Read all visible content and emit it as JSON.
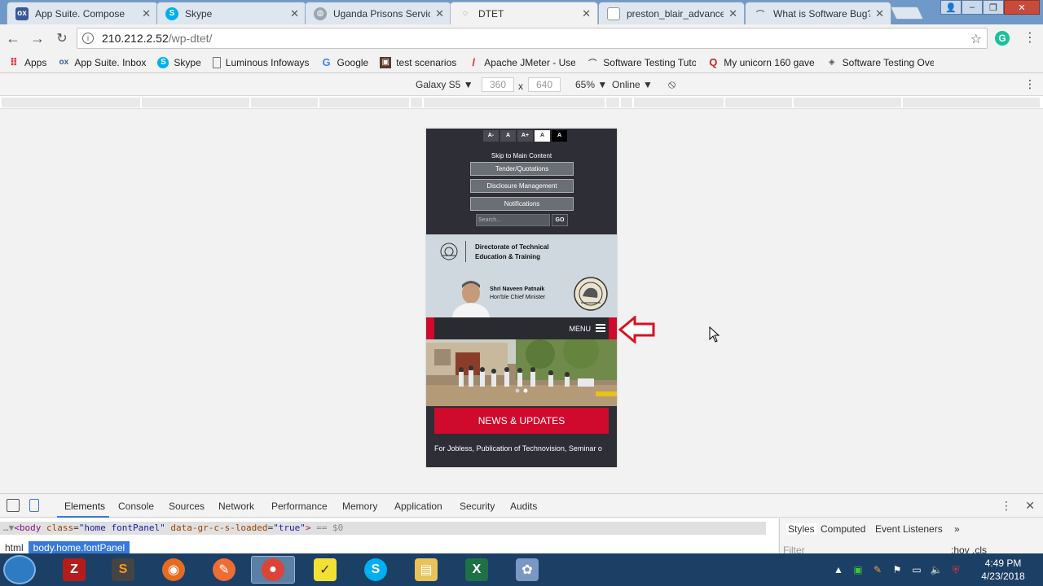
{
  "tabs": [
    {
      "title": "App Suite. Compose",
      "favicon": "ox-icon",
      "color": "#3b5998"
    },
    {
      "title": "Skype",
      "favicon": "skype-icon",
      "color": "#00aff0"
    },
    {
      "title": "Uganda Prisons Servic",
      "favicon": "globe-icon",
      "color": "#7a7a7a"
    },
    {
      "title": "DTET",
      "favicon": "loading-icon",
      "color": "#7a7a7a"
    },
    {
      "title": "preston_blair_advance",
      "favicon": "document-icon",
      "color": "#7a7a7a"
    },
    {
      "title": "What is Software Bug?",
      "favicon": "link-icon",
      "color": "#7a7a7a"
    }
  ],
  "omnibox": {
    "host": "210.212.2.52",
    "path": "/wp-dtet/"
  },
  "bookmarks": [
    {
      "label": "Apps",
      "icon": "apps-grid-icon"
    },
    {
      "label": "App Suite. Inbox",
      "icon": "ox-icon"
    },
    {
      "label": "Skype",
      "icon": "skype-icon"
    },
    {
      "label": "Luminous Infoways",
      "icon": "page-icon"
    },
    {
      "label": "Google",
      "icon": "google-icon"
    },
    {
      "label": "test scenarios",
      "icon": "scenario-icon"
    },
    {
      "label": "Apache JMeter - User",
      "icon": "feather-icon"
    },
    {
      "label": "Software Testing Tuto",
      "icon": "link-icon"
    },
    {
      "label": "My unicorn 160 gave",
      "icon": "quora-icon"
    },
    {
      "label": "Software Testing Ove",
      "icon": "diamond-icon"
    }
  ],
  "device_toolbar": {
    "device": "Galaxy S5",
    "width": "360",
    "times": "x",
    "height": "640",
    "zoom": "65%",
    "network": "Online"
  },
  "site": {
    "font_controls": [
      "A-",
      "A",
      "A+",
      "A",
      "A"
    ],
    "skip_link": "Skip to Main Content",
    "buttons": [
      "Tender/Quotations",
      "Disclosure Management",
      "Notifications"
    ],
    "search_placeholder": "Search...",
    "search_go": "GO",
    "org_title_line1": "Directorate of Technical",
    "org_title_line2": "Education & Training",
    "cm_name": "Shri Naveen Patnaik",
    "cm_role": "Hon'ble Chief Minister",
    "menu_label": "MENU",
    "news_button": "NEWS & UPDATES",
    "ticker": "For Jobless, Publication of Technovision, Seminar o"
  },
  "devtools": {
    "tabs": [
      "Elements",
      "Console",
      "Sources",
      "Network",
      "Performance",
      "Memory",
      "Application",
      "Security",
      "Audits"
    ],
    "dom_line": {
      "tag": "body",
      "class_attr": "class",
      "class_val": "\"home fontPanel\"",
      "data_attr": "data-gr-c-s-loaded",
      "data_val": "\"true\"",
      "suffix": "== $0"
    },
    "breadcrumbs": [
      "html",
      "body.home.fontPanel"
    ],
    "side_tabs": [
      "Styles",
      "Computed",
      "Event Listeners"
    ],
    "filter_placeholder": "Filter",
    "hov_cls": ":hov  .cls"
  },
  "taskbar": {
    "apps": [
      "firefox",
      "filezilla",
      "sublime-text",
      "firefox",
      "postman",
      "chrome",
      "sticky-notes",
      "skype",
      "file-explorer",
      "excel",
      "paint"
    ],
    "time": "4:49 PM",
    "date": "4/23/2018"
  },
  "colors": {
    "accent_red": "#cf0a2c",
    "dark_band": "#2e2e37",
    "annotation_arrow": "#d8121f"
  }
}
